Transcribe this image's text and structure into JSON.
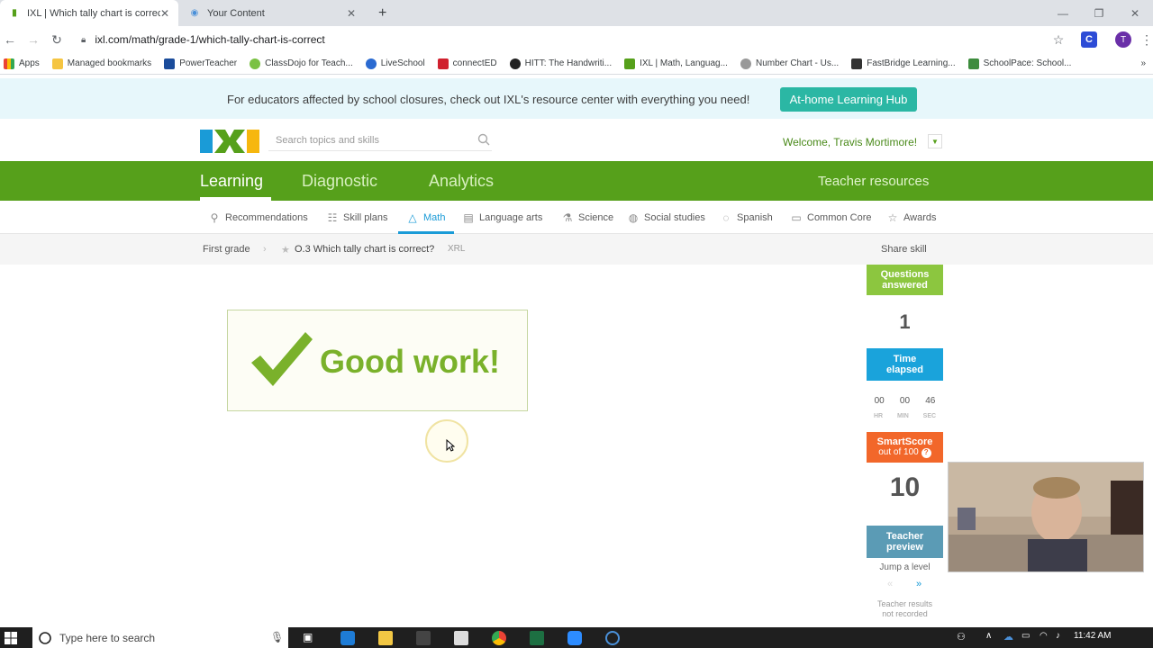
{
  "browser": {
    "tabs": [
      {
        "title": "IXL | Which tally chart is correct?",
        "active": true
      },
      {
        "title": "Your Content",
        "active": false
      }
    ],
    "url": "ixl.com/math/grade-1/which-tally-chart-is-correct",
    "profile_initial": "T",
    "bookmarks": [
      "Apps",
      "Managed bookmarks",
      "PowerTeacher",
      "ClassDojo for Teach...",
      "LiveSchool",
      "connectED",
      "HITT: The Handwriti...",
      "IXL | Math, Languag...",
      "Number Chart - Us...",
      "FastBridge Learning...",
      "SchoolPace: School..."
    ]
  },
  "banner": {
    "text": "For educators affected by school closures, check out IXL's resource center with everything you need!",
    "button": "At-home Learning Hub"
  },
  "header": {
    "search_placeholder": "Search topics and skills",
    "welcome": "Welcome, Travis Mortimore!"
  },
  "main_nav": {
    "items": [
      "Learning",
      "Diagnostic",
      "Analytics"
    ],
    "teacher_resources": "Teacher resources"
  },
  "subject_nav": [
    "Recommendations",
    "Skill plans",
    "Math",
    "Language arts",
    "Science",
    "Social studies",
    "Spanish",
    "Common Core",
    "Awards"
  ],
  "breadcrumb": {
    "grade": "First grade",
    "skill": "O.3 Which tally chart is correct?",
    "code": "XRL",
    "share": "Share skill"
  },
  "feedback": {
    "message": "Good work!"
  },
  "stats": {
    "questions_label_1": "Questions",
    "questions_label_2": "answered",
    "questions_value": "1",
    "time_label_1": "Time",
    "time_label_2": "elapsed",
    "hr": "00",
    "min": "00",
    "sec": "46",
    "hr_label": "HR",
    "min_label": "MIN",
    "sec_label": "SEC",
    "smartscore_label": "SmartScore",
    "smartscore_sub": "out of 100",
    "smartscore_value": "10",
    "teacher_preview_1": "Teacher",
    "teacher_preview_2": "preview",
    "jump_label": "Jump a level",
    "jump_prev": "«",
    "jump_next": "»",
    "teacher_note_1": "Teacher results",
    "teacher_note_2": "not recorded"
  },
  "taskbar": {
    "search_placeholder": "Type here to search",
    "time": "11:42 AM"
  },
  "colors": {
    "ixl_green": "#56a01b",
    "ixl_blue": "#1a9bd7",
    "orange": "#f2672a",
    "teal": "#2bb7a4"
  }
}
